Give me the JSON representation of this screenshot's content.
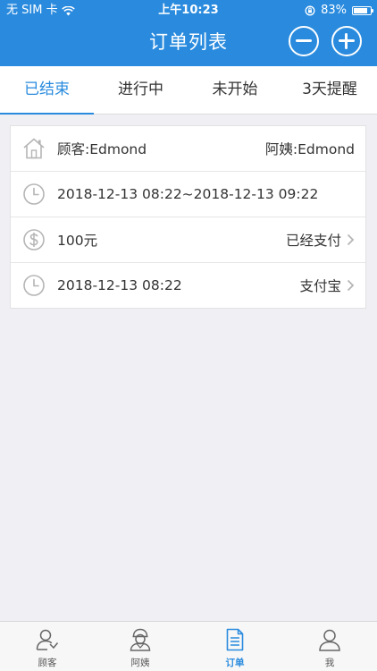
{
  "status_bar": {
    "carrier": "无 SIM 卡",
    "time": "上午10:23",
    "battery_percent": "83%",
    "battery_level": 0.83
  },
  "nav": {
    "title": "订单列表"
  },
  "tabs": [
    {
      "label": "已结束",
      "active": true
    },
    {
      "label": "进行中",
      "active": false
    },
    {
      "label": "未开始",
      "active": false
    },
    {
      "label": "3天提醒",
      "active": false
    }
  ],
  "order": {
    "customer": "顾客:Edmond",
    "helper": "阿姨:Edmond",
    "time_range": "2018-12-13 08:22~2018-12-13 09:22",
    "amount": "100元",
    "payment_status": "已经支付",
    "payment_time": "2018-12-13 08:22",
    "payment_method": "支付宝"
  },
  "tabbar": [
    {
      "label": "顾客",
      "icon": "customer-icon",
      "active": false
    },
    {
      "label": "阿姨",
      "icon": "helper-icon",
      "active": false
    },
    {
      "label": "订单",
      "icon": "order-document-icon",
      "active": true
    },
    {
      "label": "我",
      "icon": "profile-icon",
      "active": false
    }
  ],
  "colors": {
    "primary": "#2a8bde",
    "background": "#efeff4",
    "icon_gray": "#b5b5b5"
  }
}
